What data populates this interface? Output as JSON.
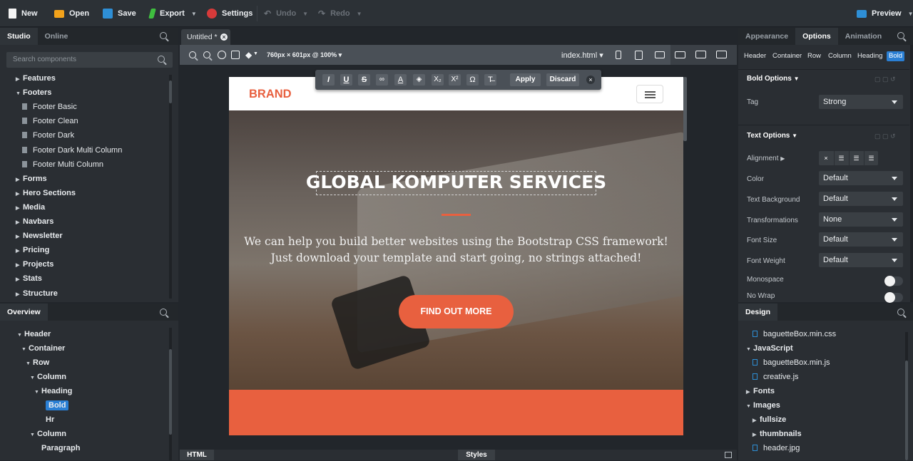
{
  "toolbar": {
    "new": "New",
    "open": "Open",
    "save": "Save",
    "export": "Export",
    "settings": "Settings",
    "undo": "Undo",
    "redo": "Redo",
    "preview": "Preview"
  },
  "left": {
    "tabs": [
      "Studio",
      "Online"
    ],
    "search_placeholder": "Search components",
    "components": [
      {
        "label": "Features",
        "kind": "folder"
      },
      {
        "label": "Footers",
        "kind": "folder-open"
      },
      {
        "label": "Footer Basic",
        "kind": "file"
      },
      {
        "label": "Footer Clean",
        "kind": "file"
      },
      {
        "label": "Footer Dark",
        "kind": "file"
      },
      {
        "label": "Footer Dark Multi Column",
        "kind": "file"
      },
      {
        "label": "Footer Multi Column",
        "kind": "file"
      },
      {
        "label": "Forms",
        "kind": "folder"
      },
      {
        "label": "Hero Sections",
        "kind": "folder"
      },
      {
        "label": "Media",
        "kind": "folder"
      },
      {
        "label": "Navbars",
        "kind": "folder"
      },
      {
        "label": "Newsletter",
        "kind": "folder"
      },
      {
        "label": "Pricing",
        "kind": "folder"
      },
      {
        "label": "Projects",
        "kind": "folder"
      },
      {
        "label": "Stats",
        "kind": "folder"
      },
      {
        "label": "Structure",
        "kind": "folder"
      }
    ],
    "overview_title": "Overview",
    "overview": [
      {
        "label": "Header",
        "level": 0,
        "open": true
      },
      {
        "label": "Container",
        "level": 1,
        "open": true
      },
      {
        "label": "Row",
        "level": 2,
        "open": true
      },
      {
        "label": "Column",
        "level": 3,
        "open": true
      },
      {
        "label": "Heading",
        "level": 4,
        "open": true
      },
      {
        "label": "Bold",
        "level": 5,
        "selected": true
      },
      {
        "label": "Hr",
        "level": 5
      },
      {
        "label": "Column",
        "level": 3,
        "open": true
      },
      {
        "label": "Paragraph",
        "level": 4
      }
    ]
  },
  "center": {
    "doc_tab": "Untitled *",
    "size_label": "760px × 601px @ 100%",
    "file_select": "index.html",
    "format_toolbar": {
      "apply": "Apply",
      "discard": "Discard"
    },
    "page": {
      "brand": "BRAND",
      "heading": "GLOBAL KOMPUTER SERVICES",
      "paragraph_line1": "We can help you build better websites using the Bootstrap CSS framework!",
      "paragraph_line2": "Just download your template and start going, no strings attached!",
      "cta": "FIND OUT MORE"
    },
    "bottom_tabs": {
      "html": "HTML",
      "styles": "Styles"
    }
  },
  "right": {
    "tabs": [
      "Appearance",
      "Options",
      "Animation"
    ],
    "breadcrumb": [
      "Header",
      "Container",
      "Row",
      "Column",
      "Heading",
      "Bold"
    ],
    "bold_options_title": "Bold Options",
    "tag_label": "Tag",
    "tag_value": "Strong",
    "text_options_title": "Text Options",
    "props": [
      {
        "label": "Alignment",
        "type": "align"
      },
      {
        "label": "Color",
        "value": "Default"
      },
      {
        "label": "Text Background",
        "value": "Default"
      },
      {
        "label": "Transformations",
        "value": "None"
      },
      {
        "label": "Font Size",
        "value": "Default"
      },
      {
        "label": "Font Weight",
        "value": "Default"
      },
      {
        "label": "Monospace",
        "type": "toggle"
      },
      {
        "label": "No Wrap",
        "type": "toggle"
      }
    ],
    "design_title": "Design",
    "design_files": [
      {
        "label": "baguetteBox.min.css",
        "kind": "file",
        "level": 1
      },
      {
        "label": "JavaScript",
        "kind": "folder-open",
        "level": 0
      },
      {
        "label": "baguetteBox.min.js",
        "kind": "file",
        "level": 1
      },
      {
        "label": "creative.js",
        "kind": "file",
        "level": 1
      },
      {
        "label": "Fonts",
        "kind": "folder",
        "level": 0
      },
      {
        "label": "Images",
        "kind": "folder-open",
        "level": 0
      },
      {
        "label": "fullsize",
        "kind": "folder",
        "level": 1
      },
      {
        "label": "thumbnails",
        "kind": "folder",
        "level": 1
      },
      {
        "label": "header.jpg",
        "kind": "image",
        "level": 1
      }
    ]
  },
  "colors": {
    "accent": "#e8603f",
    "selection": "#2a7fd4",
    "panel": "#2a2e33"
  }
}
